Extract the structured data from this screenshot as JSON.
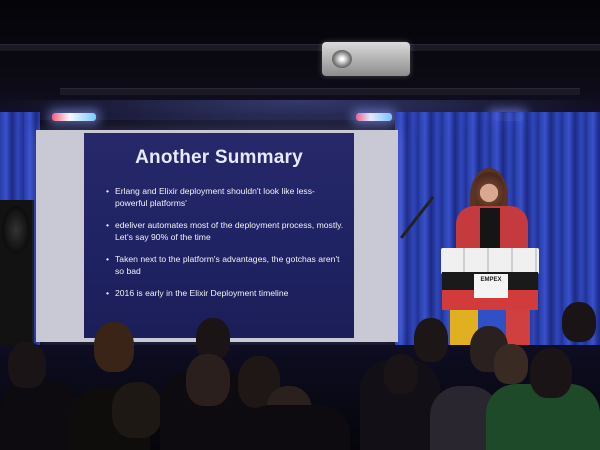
{
  "slide": {
    "title": "Another Summary",
    "bullets": [
      "Erlang and Elixir deployment shouldn't look like less-powerful platforms'",
      "edeliver automates most of the deployment process, mostly.  Let's say 90% of the time",
      "Taken next to the platform's advantages, the gotchas aren't so bad",
      "2016 is early in the Elixir Deployment timeline"
    ]
  },
  "lectern": {
    "sign_text": "EMPEX"
  }
}
